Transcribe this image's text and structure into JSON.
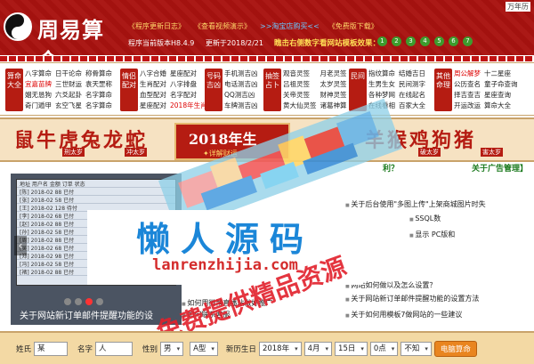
{
  "header": {
    "logo_title": "周易算命",
    "links": [
      "《程序更新日志》",
      "《查看视频演示》"
    ],
    "links_blue": [
      ">>淘宝店购买<<",
      "《免费版下载》"
    ],
    "version": "程序当前版本H8.4.9",
    "update": "更新于2018/2/21",
    "hint": "瞧击右侧数字看网站模板效果：",
    "template_numbers": [
      "1",
      "2",
      "3",
      "4",
      "5",
      "6",
      "7"
    ],
    "corner_brand": "万年历"
  },
  "categories": [
    {
      "badge": "算命大全",
      "cols": [
        [
          "八字算命",
          "宜嘉苗牌",
          "姻无恳狗",
          "奇门遁甲"
        ],
        [
          "日干论命",
          "三世财运",
          "六爻起卦",
          "玄空飞星"
        ],
        [
          "称骨算命",
          "袁天罡称",
          "名字算命",
          "名字算命"
        ]
      ]
    },
    {
      "badge": "情侣配对",
      "cols": [
        [
          "八字合婚",
          "生肖配对",
          "血型配对",
          "星座配对"
        ],
        [
          "星座配对",
          "八字排盘",
          "名字配对",
          "2018年生肖运程"
        ]
      ]
    },
    {
      "badge": "号码吉凶",
      "cols": [
        [
          "手机测吉凶",
          "电话测吉凶",
          "QQ测吉凶",
          "车牌测吉凶"
        ]
      ]
    },
    {
      "badge": "抽签占卜",
      "cols": [
        [
          "观音灵签",
          "吕祖灵签",
          "关帝灵签",
          "黄大仙灵签"
        ],
        [
          "月老灵签",
          "太岁灵签",
          "财神灵签",
          "诸葛神算"
        ]
      ]
    },
    {
      "badge": "民间",
      "cols": [
        [
          "指纹算命",
          "生男生女",
          "各种梦网",
          "在线看相"
        ],
        [
          "结婚吉日",
          "民间测字",
          "在线起名",
          "百家大全"
        ]
      ]
    },
    {
      "badge": "其他命理",
      "cols": [
        [
          "周公解梦",
          "公历查名",
          "择吉查吉",
          "开运改运"
        ],
        [
          "十二星座",
          "童子命查询",
          "星座查询",
          "算命大全"
        ]
      ]
    }
  ],
  "zodiac": {
    "left": "鼠牛虎兔龙蛇",
    "left_tags": [
      "刑太岁",
      "冲太岁"
    ],
    "center_year": "2018年生",
    "center_sub": "✦详解财运",
    "right": "羊猴鸡狗猪",
    "right_tags": [
      "破太岁",
      "害太岁"
    ]
  },
  "slider": {
    "caption": "关于网站新订单邮件提醒功能的设",
    "rows": [
      "地址 用户名 金额 订单 状态",
      "[陈] 2018-02 88 已付",
      "[张] 2018-02 58 已付",
      "[王] 2018-02 128 待付",
      "[李] 2018-02 68 已付",
      "[赵] 2018-02 88 已付",
      "[孙] 2018-02 58 已付",
      "[周] 2018-02 88 已付",
      "[吴] 2018-02 68 已付",
      "[郑] 2018-02 98 已付",
      "[冯] 2018-02 58 已付",
      "[褚] 2018-02 88 已付"
    ]
  },
  "news": {
    "head1": "利？",
    "head2": "关于广告管理】",
    "items": [
      "关于后台使用\"多图上传\"上架商城图片时失",
      "SSQL数",
      "显示 PC版和",
      "关于网站新订单邮件提醒功能的设置方法",
      "关于如何用模板7做网站的一些建议",
      "如何用微博直播站做好推广",
      "如何联系客服",
      "网站如何做以及怎么设置？"
    ]
  },
  "watermark": {
    "title": "懒人源码",
    "url": "lanrenzhijia.com",
    "script": "免费提供精品资源"
  },
  "form": {
    "surname_label": "姓氏",
    "surname_value": "某",
    "name_label": "名字",
    "name_value": "人",
    "gender_label": "性别",
    "gender_value": "男",
    "blood_value": "A型",
    "calendar_label": "新历生日",
    "year": "2018年",
    "month": "4月",
    "day": "15日",
    "hour": "0点",
    "minute": "不知",
    "submit": "电脑算命"
  }
}
